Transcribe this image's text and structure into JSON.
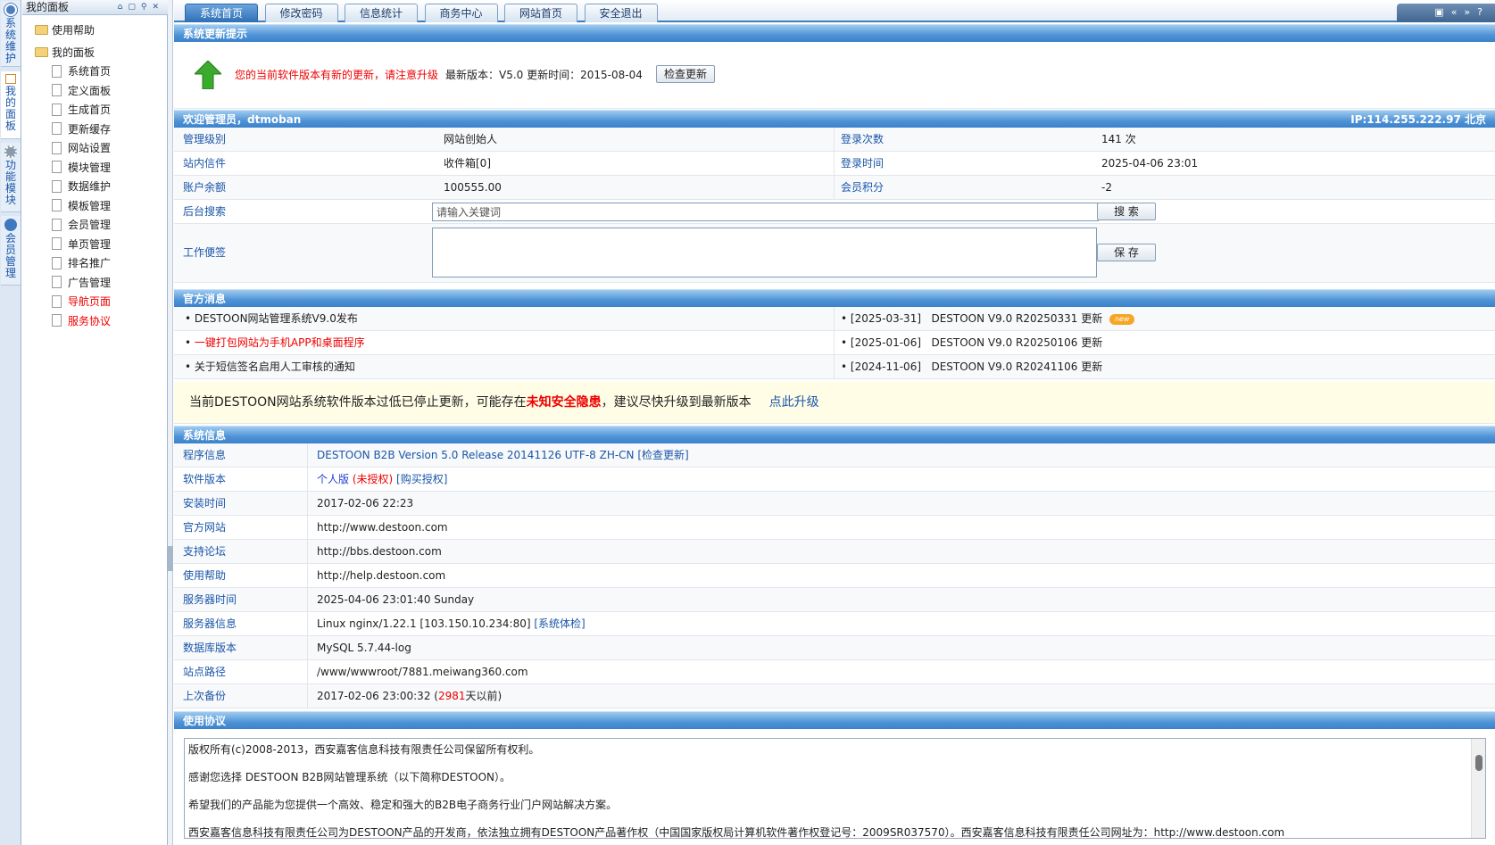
{
  "vstrip": [
    {
      "label": "系统维护",
      "icon": "clock-icon",
      "active": false
    },
    {
      "label": "我的面板",
      "icon": "home-icon",
      "active": true
    },
    {
      "label": "功能模块",
      "icon": "gear-icon",
      "active": false
    },
    {
      "label": "会员管理",
      "icon": "user-icon",
      "active": false
    }
  ],
  "sidebar": {
    "title": "我的面板",
    "folders": [
      {
        "label": "使用帮助"
      },
      {
        "label": "我的面板"
      }
    ],
    "items": [
      {
        "label": "系统首页",
        "red": false
      },
      {
        "label": "定义面板",
        "red": false
      },
      {
        "label": "生成首页",
        "red": false
      },
      {
        "label": "更新缓存",
        "red": false
      },
      {
        "label": "网站设置",
        "red": false
      },
      {
        "label": "模块管理",
        "red": false
      },
      {
        "label": "数据维护",
        "red": false
      },
      {
        "label": "模板管理",
        "red": false
      },
      {
        "label": "会员管理",
        "red": false
      },
      {
        "label": "单页管理",
        "red": false
      },
      {
        "label": "排名推广",
        "red": false
      },
      {
        "label": "广告管理",
        "red": false
      },
      {
        "label": "导航页面",
        "red": true
      },
      {
        "label": "服务协议",
        "red": true
      }
    ]
  },
  "tabs": [
    {
      "label": "系统首页",
      "active": true
    },
    {
      "label": "修改密码",
      "active": false
    },
    {
      "label": "信息统计",
      "active": false
    },
    {
      "label": "商务中心",
      "active": false
    },
    {
      "label": "网站首页",
      "active": false
    },
    {
      "label": "安全退出",
      "active": false
    }
  ],
  "update": {
    "title": "系统更新提示",
    "warning": "您的当前软件版本有新的更新，请注意升级",
    "info": "最新版本：V5.0 更新时间：2015-08-04",
    "check_button": "检查更新"
  },
  "welcome": {
    "title": "欢迎管理员，dtmoban",
    "ip": "IP:114.255.222.97 北京",
    "rows": [
      {
        "l1": "管理级别",
        "v1": "网站创始人",
        "l2": "登录次数",
        "v2": "141 次"
      },
      {
        "l1": "站内信件",
        "v1": "收件箱[0]",
        "l2": "登录时间",
        "v2": "2025-04-06 23:01"
      },
      {
        "l1": "账户余额",
        "v1": "100555.00",
        "l2": "会员积分",
        "v2": "-2"
      }
    ],
    "search_label": "后台搜索",
    "search_placeholder": "请输入关键词",
    "search_button": "搜 索",
    "memo_label": "工作便签",
    "save_button": "保 存"
  },
  "official": {
    "title": "官方消息",
    "left": [
      {
        "text": "DESTOON网站管理系统V9.0发布",
        "red": false
      },
      {
        "text": "一键打包网站为手机APP和桌面程序",
        "red": true
      },
      {
        "text": "关于短信签名启用人工审核的通知",
        "red": false
      }
    ],
    "right": [
      {
        "date": "[2025-03-31]",
        "text": "DESTOON V9.0 R20250331 更新",
        "badge": "new"
      },
      {
        "date": "[2025-01-06]",
        "text": "DESTOON V9.0 R20250106 更新",
        "badge": ""
      },
      {
        "date": "[2024-11-06]",
        "text": "DESTOON V9.0 R20241106 更新",
        "badge": ""
      }
    ]
  },
  "notice": {
    "pre": "当前DESTOON网站系统软件版本过低已停止更新，可能存在",
    "warn": "未知安全隐患",
    "post": "，建议尽快升级到最新版本",
    "link": "点此升级"
  },
  "sysinfo": {
    "title": "系统信息",
    "rows": [
      {
        "label": "程序信息",
        "value": "DESTOON B2B Version 5.0 Release 20141126 UTF-8 ZH-CN [检查更新]",
        "kind": "link"
      },
      {
        "label": "软件版本",
        "a": "个人版",
        "b": "(未授权)",
        "c": "[购买授权]",
        "kind": "version"
      },
      {
        "label": "安装时间",
        "value": "2017-02-06 22:23"
      },
      {
        "label": "官方网站",
        "value": "http://www.destoon.com"
      },
      {
        "label": "支持论坛",
        "value": "http://bbs.destoon.com"
      },
      {
        "label": "使用帮助",
        "value": "http://help.destoon.com"
      },
      {
        "label": "服务器时间",
        "value": "2025-04-06 23:01:40 Sunday"
      },
      {
        "label": "服务器信息",
        "value": "Linux nginx/1.22.1 [103.150.10.234:80]",
        "extra": "[系统体检]",
        "kind": "server"
      },
      {
        "label": "数据库版本",
        "value": "MySQL 5.7.44-log"
      },
      {
        "label": "站点路径",
        "value": "/www/wwwroot/7881.meiwang360.com"
      },
      {
        "label": "上次备份",
        "pre": "2017-02-06 23:00:32 (",
        "days": "2981",
        "post": "天以前)",
        "kind": "backup"
      }
    ]
  },
  "license": {
    "title": "使用协议",
    "paragraphs": [
      "版权所有(c)2008-2013，西安嘉客信息科技有限责任公司保留所有权利。",
      "感谢您选择 DESTOON B2B网站管理系统（以下简称DESTOON）。",
      "希望我们的产品能为您提供一个高效、稳定和强大的B2B电子商务行业门户网站解决方案。",
      "西安嘉客信息科技有限责任公司为DESTOON产品的开发商，依法独立拥有DESTOON产品著作权（中国国家版权局计算机软件著作权登记号：2009SR037570）。西安嘉客信息科技有限责任公司网址为：http://www.destoon.com"
    ]
  },
  "colors": {
    "accent": "#3b82cc",
    "link": "#1a56a8",
    "warn": "#e00000",
    "notice_bg": "#fffde6"
  }
}
